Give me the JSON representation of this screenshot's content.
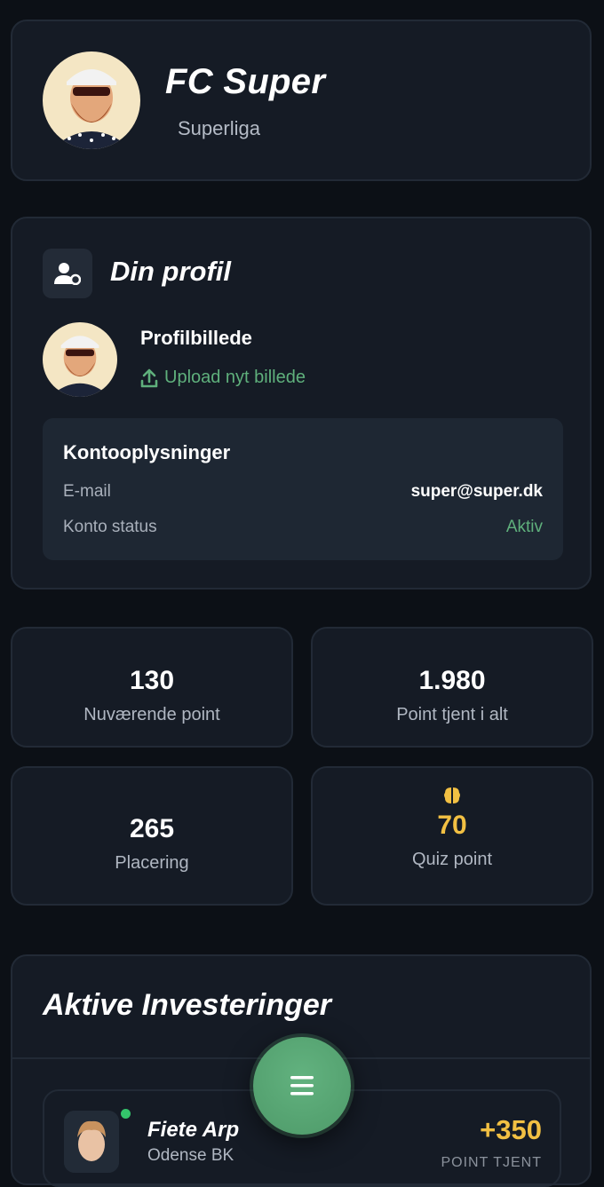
{
  "header": {
    "club_name": "FC Super",
    "league": "Superliga"
  },
  "profile": {
    "title": "Din profil",
    "picture_label": "Profilbillede",
    "upload_label": "Upload nyt billede",
    "account": {
      "title": "Kontooplysninger",
      "email_label": "E-mail",
      "email_value": "super@super.dk",
      "status_label": "Konto status",
      "status_value": "Aktiv"
    }
  },
  "stats": [
    {
      "value": "130",
      "label": "Nuværende point"
    },
    {
      "value": "1.980",
      "label": "Point tjent i alt"
    },
    {
      "value": "265",
      "label": "Placering"
    },
    {
      "value": "70",
      "label": "Quiz point",
      "icon": "brain-icon"
    }
  ],
  "investments": {
    "title": "Aktive Investeringer",
    "items": [
      {
        "name": "Fiete Arp",
        "club": "Odense BK",
        "gain": "+350",
        "gain_label": "POINT TJENT"
      }
    ]
  },
  "colors": {
    "background": "#0c1016",
    "card": "#151b25",
    "accent_green": "#5fb07c",
    "gold": "#f2c043"
  },
  "fab_icon": "menu-icon"
}
